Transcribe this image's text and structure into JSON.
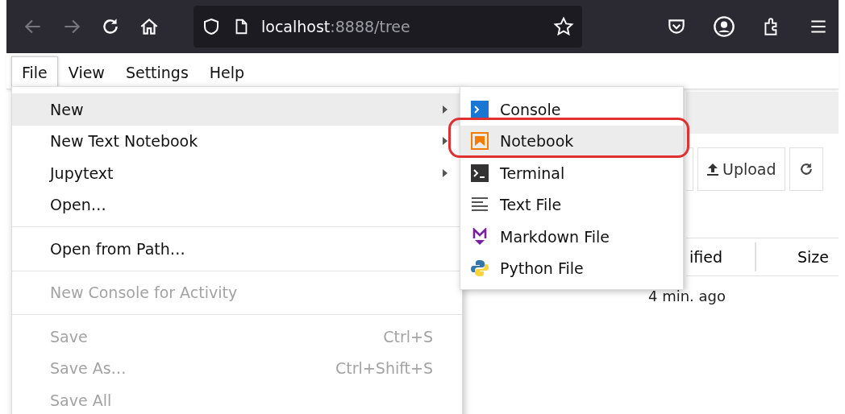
{
  "browser": {
    "nav": [
      {
        "kind": "back",
        "disabled": true
      },
      {
        "kind": "forward",
        "disabled": true
      },
      {
        "kind": "reload",
        "disabled": false
      },
      {
        "kind": "home",
        "disabled": false
      }
    ],
    "url": {
      "host": "localhost",
      "rest": ":8888/tree"
    }
  },
  "menubar": [
    {
      "label": "File",
      "selected": true
    },
    {
      "label": "View",
      "selected": false
    },
    {
      "label": "Settings",
      "selected": false
    },
    {
      "label": "Help",
      "selected": false
    }
  ],
  "file_menu": [
    {
      "kind": "item",
      "label": "New",
      "submenu": true,
      "selected": true,
      "disabled": false
    },
    {
      "kind": "item",
      "label": "New Text Notebook",
      "submenu": true,
      "selected": false,
      "disabled": false
    },
    {
      "kind": "item",
      "label": "Jupytext",
      "submenu": true,
      "selected": false,
      "disabled": false
    },
    {
      "kind": "item",
      "label": "Open…",
      "submenu": false,
      "selected": false,
      "disabled": false
    },
    {
      "kind": "separator"
    },
    {
      "kind": "item",
      "label": "Open from Path…",
      "submenu": false,
      "selected": false,
      "disabled": false
    },
    {
      "kind": "separator"
    },
    {
      "kind": "item",
      "label": "New Console for Activity",
      "submenu": false,
      "selected": false,
      "disabled": true
    },
    {
      "kind": "separator"
    },
    {
      "kind": "item",
      "label": "Save",
      "shortcut": "Ctrl+S",
      "submenu": false,
      "selected": false,
      "disabled": true
    },
    {
      "kind": "item",
      "label": "Save As…",
      "shortcut": "Ctrl+Shift+S",
      "submenu": false,
      "selected": false,
      "disabled": true
    },
    {
      "kind": "item",
      "label": "Save All",
      "submenu": false,
      "selected": false,
      "disabled": true
    }
  ],
  "new_submenu": [
    {
      "kind": "console",
      "label": "Console",
      "selected": false,
      "highlighted": false
    },
    {
      "kind": "notebook",
      "label": "Notebook",
      "selected": true,
      "highlighted": true
    },
    {
      "kind": "terminal",
      "label": "Terminal",
      "selected": false,
      "highlighted": false
    },
    {
      "kind": "text",
      "label": "Text File",
      "selected": false,
      "highlighted": false
    },
    {
      "kind": "markdown",
      "label": "Markdown File",
      "selected": false,
      "highlighted": false
    },
    {
      "kind": "python",
      "label": "Python File",
      "selected": false,
      "highlighted": false
    }
  ],
  "file_browser": {
    "upload_button": "Upload",
    "columns": [
      "ified",
      "Size"
    ],
    "rows": [
      {
        "modified": "4 min. ago"
      }
    ]
  }
}
